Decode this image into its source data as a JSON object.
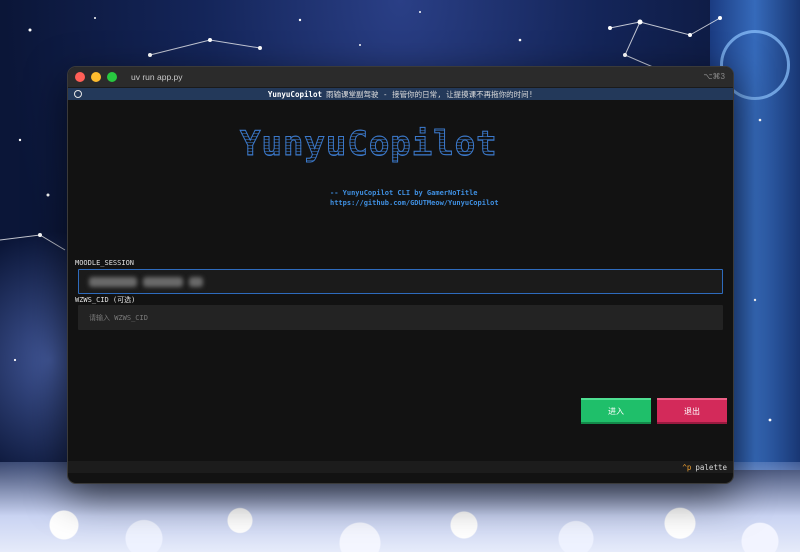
{
  "window": {
    "title": "uv run app.py",
    "shortcut": "⌥⌘3"
  },
  "app_header": {
    "name": "YunyuCopilot",
    "tagline": "雨输课堂副驾驶 - 接管你的日常, 让提摸课不再拖你的时间!"
  },
  "logo": {
    "text": "YunyuCopilot"
  },
  "credit": {
    "line1": "-- YunyuCopilot CLI by GamerNoTitle",
    "line2": "https://github.com/GDUTMeow/YunyuCopilot"
  },
  "form": {
    "session_label": "MOODLE_SESSION",
    "cid_label": "WZWS_CID (可选)",
    "cid_placeholder": "请输入 WZWS_CID"
  },
  "buttons": {
    "enter": "进入",
    "exit": "退出"
  },
  "footer": {
    "key": "^p",
    "label": "palette"
  },
  "colors": {
    "header_bg": "#23395a",
    "logo_blue": "#3b78c9",
    "link_blue": "#3f8fe0",
    "enter_green": "#1fbf6a",
    "exit_red": "#d32a5a"
  }
}
